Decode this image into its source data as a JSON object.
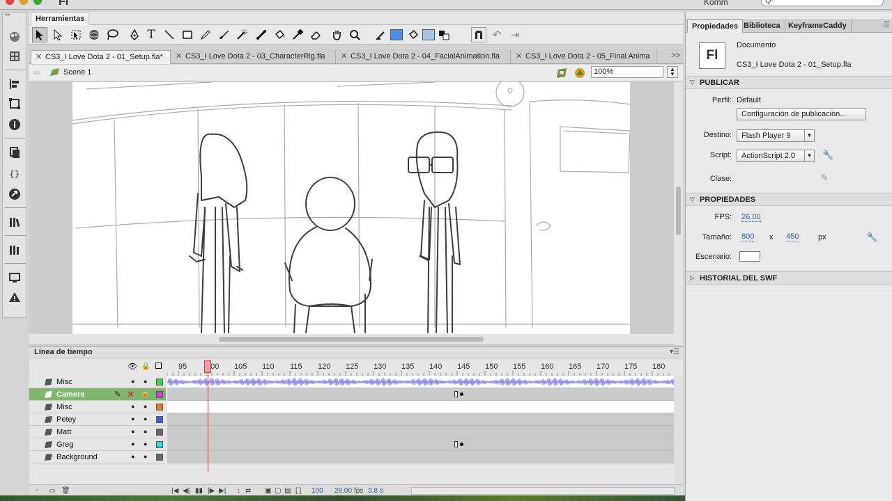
{
  "app": {
    "logo": "Fl",
    "workspace": "Komm",
    "search_placeholder": "Q-"
  },
  "tools_panel": {
    "title": "Herramientas"
  },
  "tabs": [
    {
      "label": "CS3_I Love Dota 2 - 01_Setup.fla*",
      "active": true
    },
    {
      "label": "CS3_I Love Dota 2 - 03_CharacterRig.fla",
      "active": false
    },
    {
      "label": "CS3_I Love Dota 2 - 04_FacialAnimation.fla",
      "active": false
    },
    {
      "label": "CS3_I Love Dota 2 - 05_Final Anima",
      "active": false
    }
  ],
  "editbar": {
    "scene": "Scene 1",
    "zoom": "100%"
  },
  "timeline": {
    "title": "Línea de tiempo",
    "ruler": [
      "95",
      "100",
      "105",
      "110",
      "115",
      "120",
      "125",
      "130",
      "135",
      "140",
      "145",
      "150",
      "155",
      "160",
      "165",
      "170",
      "175",
      "180"
    ],
    "current_frame": 100,
    "layers": [
      {
        "name": "Misc",
        "color": "#4ccc4c",
        "active": false,
        "white": true,
        "audio": true
      },
      {
        "name": "Camera",
        "color": "#cc44cc",
        "active": true,
        "white": false,
        "keyframe": 145
      },
      {
        "name": "Misc",
        "color": "#e67a1e",
        "active": false,
        "white": true
      },
      {
        "name": "Petey",
        "color": "#3b5fd9",
        "active": false,
        "white": false
      },
      {
        "name": "Matt",
        "color": "#666666",
        "active": false,
        "white": false
      },
      {
        "name": "Greg",
        "color": "#33d6e0",
        "active": false,
        "white": false,
        "keyframe": 145
      },
      {
        "name": "Background",
        "color": "#666666",
        "active": false,
        "white": false
      }
    ],
    "status": {
      "frame": "100",
      "fps": "26.00",
      "fps_unit": "fps",
      "time": "3.8 s"
    }
  },
  "properties": {
    "tabs": [
      "Propiedades",
      "Biblioteca",
      "KeyframeCaddy"
    ],
    "doc_icon": "Fl",
    "doc_type": "Documento",
    "doc_name": "CS3_I Love Dota 2 - 01_Setup.fla",
    "publish_section": "PUBLICAR",
    "perfil_label": "Perfil:",
    "perfil_value": "Default",
    "publish_settings_btn": "Configuración de publicación...",
    "destino_label": "Destino:",
    "destino_value": "Flash Player 9",
    "script_label": "Script:",
    "script_value": "ActionScript 2.0",
    "clase_label": "Clase:",
    "props_section": "PROPIEDADES",
    "fps_label": "FPS:",
    "fps_value": "26.00",
    "size_label": "Tamaño:",
    "width": "800",
    "x": "x",
    "height": "450",
    "px": "px",
    "stage_label": "Escenario:",
    "history_section": "HISTORIAL DEL SWF"
  }
}
